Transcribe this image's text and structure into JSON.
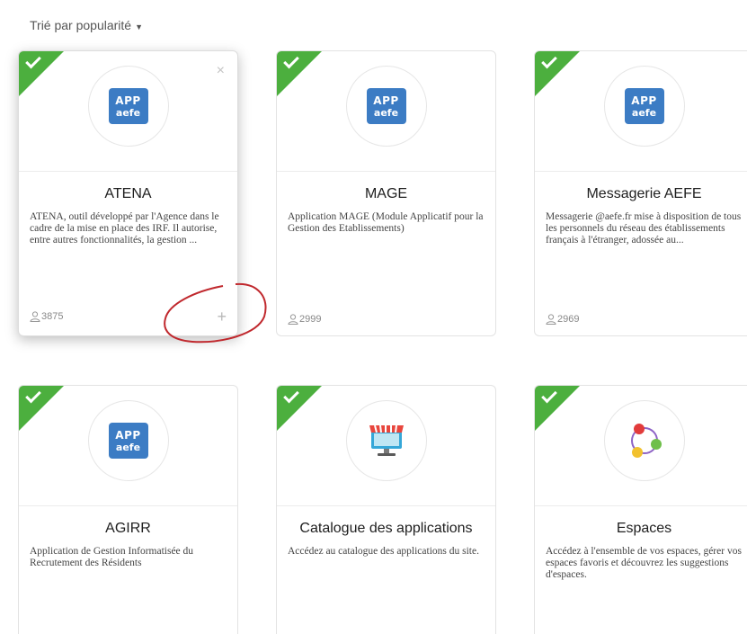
{
  "sort": {
    "label": "Trié par popularité"
  },
  "cards": [
    {
      "title": "ATENA",
      "description": "ATENA, outil développé par l'Agence dans le cadre de la mise en place des IRF. Il autorise, entre autres fonctionnalités, la gestion ...",
      "users": "3875",
      "icon": {
        "line1": "APP",
        "line2": "aefe"
      }
    },
    {
      "title": "MAGE",
      "description": "Application MAGE (Module Applicatif pour la Gestion des Etablissements)",
      "users": "2999",
      "icon": {
        "line1": "APP",
        "line2": "aefe"
      }
    },
    {
      "title": "Messagerie AEFE",
      "description": "Messagerie @aefe.fr mise à disposition de tous les personnels du réseau des établissements français à l'étranger, adossée au...",
      "users": "2969",
      "icon": {
        "line1": "APP",
        "line2": "aefe"
      }
    },
    {
      "title": "AGIRR",
      "description": "Application de Gestion Informatisée du Recrutement des Résidents",
      "icon": {
        "line1": "APP",
        "line2": "aefe"
      }
    },
    {
      "title": "Catalogue des applications",
      "description": "Accédez au catalogue des applications du site."
    },
    {
      "title": "Espaces",
      "description": "Accédez à l'ensemble de vos espaces, gérer vos espaces favoris et découvrez les suggestions d'espaces."
    }
  ],
  "colors": {
    "check": "#4caf3e",
    "app_icon": "#3c7cc4",
    "annotation": "#c0282d"
  },
  "icons": {
    "sort": "caret-down-icon",
    "installed": "check-icon",
    "close": "close-icon",
    "add": "plus-icon",
    "users": "user-icon"
  }
}
